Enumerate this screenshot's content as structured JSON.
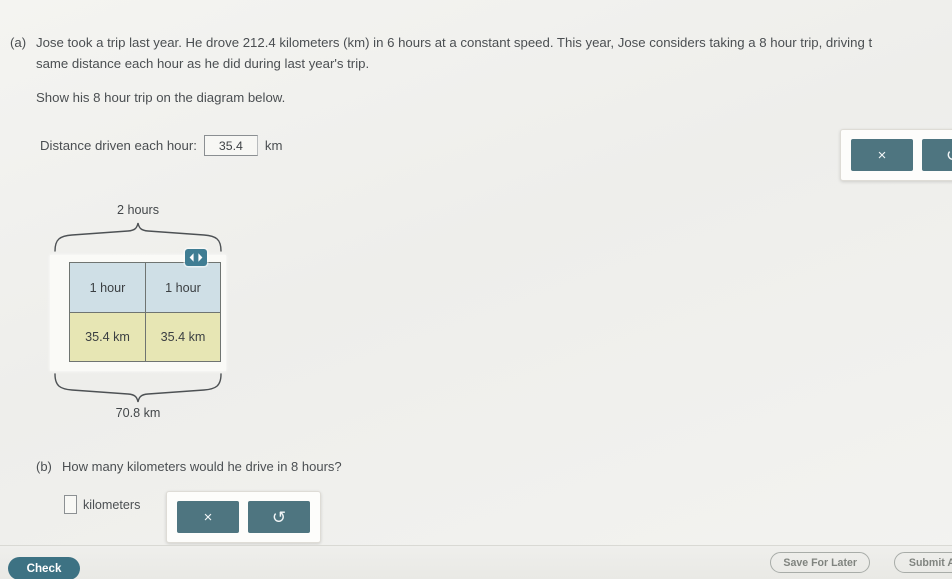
{
  "question_a": {
    "label": "(a)",
    "line1": "Jose took a trip last year. He drove 212.4 kilometers (km) in 6 hours at a constant speed. This year, Jose considers taking a 8 hour trip, driving t",
    "line2": "same distance each hour as he did during last year's trip.",
    "instruction": "Show his 8 hour trip on the diagram below.",
    "field_label": "Distance driven each hour:",
    "field_value": "35.4",
    "field_unit": "km"
  },
  "diagram": {
    "top_brace_label": "2 hours",
    "bottom_brace_label": "70.8 km",
    "time_cells": [
      "1 hour",
      "1 hour"
    ],
    "distance_cells": [
      "35.4 km",
      "35.4 km"
    ],
    "resize_handle_icon": "resize-horizontal-icon",
    "colors": {
      "time_row": "#cfdfe6",
      "distance_row": "#e7e6b4",
      "border": "#6f7471",
      "handle": "#3f7d93"
    }
  },
  "question_b": {
    "label": "(b)",
    "text": "How many kilometers would he drive in 8 hours?",
    "answer_value": "",
    "answer_unit": "kilometers"
  },
  "keypad_b": {
    "clear_label": "×",
    "undo_label": "↺"
  },
  "keypad_top": {
    "clear_label": "×",
    "undo_label": "↺"
  },
  "bottom_bar": {
    "check_label": "Check",
    "save_label": "Save For Later",
    "submit_label": "Submit A"
  }
}
